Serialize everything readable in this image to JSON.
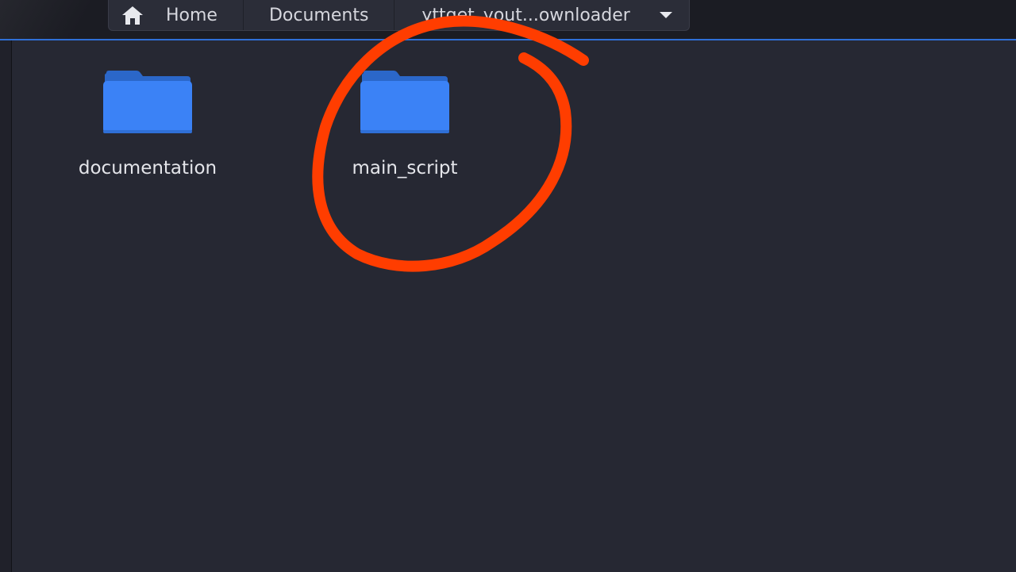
{
  "breadcrumb": {
    "items": [
      {
        "label": "Home"
      },
      {
        "label": "Documents"
      },
      {
        "label": "yttget_yout...ownloader"
      }
    ]
  },
  "files": [
    {
      "name": "documentation",
      "type": "folder"
    },
    {
      "name": "main_script",
      "type": "folder"
    }
  ],
  "colors": {
    "background": "#262833",
    "accent": "#2f6fd6",
    "folder": "#3b82f6",
    "annotation": "#ff3d00"
  },
  "icons": {
    "home": "home-icon",
    "dropdown": "chevron-down-icon",
    "folder": "folder-icon"
  }
}
